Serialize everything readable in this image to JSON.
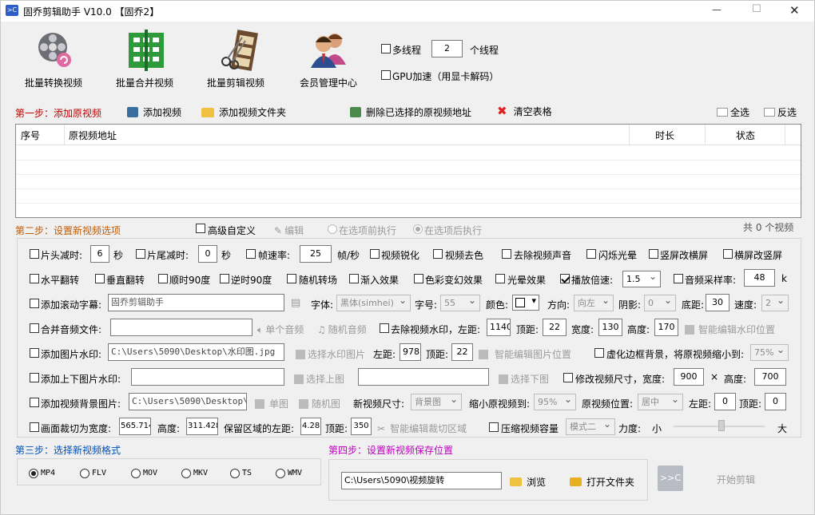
{
  "window": {
    "title": "固乔剪辑助手 V10.0  【固乔2】",
    "buttons": {
      "minimize": "—",
      "maximize": "☐",
      "close": "✕"
    }
  },
  "toolbar": {
    "batch_convert": "批量转换视频",
    "batch_merge": "批量合并视频",
    "batch_edit": "批量剪辑视频",
    "member_center": "会员管理中心",
    "multithread_label": "多线程",
    "thread_count": "2",
    "thread_unit": "个线程",
    "gpu_label": "GPU加速（用显卡解码）"
  },
  "step1": {
    "title": "第一步：添加原视频",
    "add_video": "添加视频",
    "add_folder": "添加视频文件夹",
    "delete_selected": "删除已选择的原视频地址",
    "clear_table": "清空表格",
    "select_all": "全选",
    "invert": "反选",
    "columns": [
      "序号",
      "原视频地址",
      "时长",
      "状态"
    ],
    "count": "共 0 个视频"
  },
  "step2": {
    "title": "第二步：设置新视频选项",
    "advanced_custom": "高级自定义",
    "edit": "编辑",
    "before_option": "在选项前执行",
    "after_option": "在选项后执行",
    "row1": {
      "head_trim": "片头减时:",
      "head_val": "6",
      "sec1": "秒",
      "tail_trim": "片尾减时:",
      "tail_val": "0",
      "sec2": "秒",
      "framerate": "帧速率:",
      "framerate_val": "25",
      "fps_unit": "帧/秒",
      "sharpen": "视频锐化",
      "decolor": "视频去色",
      "mute": "去除视频声音",
      "flash": "闪烁光晕",
      "v2h": "竖屏改横屏",
      "h2v": "横屏改竖屏"
    },
    "row2": {
      "hflip": "水平翻转",
      "vflip": "垂直翻转",
      "rot90cw": "顺时90度",
      "rot90ccw": "逆时90度",
      "random_trans": "随机转场",
      "fade_in": "渐入效果",
      "color_effect": "色彩变幻效果",
      "halo": "光晕效果",
      "speed": "播放倍速:",
      "speed_val": "1.5",
      "audio_rate": "音频采样率:",
      "audio_rate_val": "48",
      "audio_unit": "k"
    },
    "row3": {
      "scroll_sub": "添加滚动字幕:",
      "sub_text": "固乔剪辑助手",
      "font_label": "字体:",
      "font_val": "黑体(simhei)",
      "size_label": "字号:",
      "size_val": "55",
      "color_label": "颜色:",
      "dir_label": "方向:",
      "dir_val": "向左",
      "shadow_label": "阴影:",
      "shadow_val": "0",
      "bottom_label": "底距:",
      "bottom_val": "30",
      "speed_label": "速度:",
      "speed_val": "2"
    },
    "row4": {
      "merge_audio": "合并音频文件:",
      "single_audio": "单个音频",
      "random_audio": "随机音频",
      "remove_wm": "去除视频水印，左距:",
      "wm_left": "1140",
      "top_label": "顶距:",
      "wm_top": "22",
      "width_label": "宽度:",
      "wm_width": "130",
      "height_label": "高度:",
      "wm_height": "170",
      "smart_wm": "智能编辑水印位置"
    },
    "row5": {
      "img_wm": "添加图片水印:",
      "img_path": "C:\\Users\\5090\\Desktop\\水印图.jpg",
      "choose_wm": "选择水印图片",
      "left_label": "左距:",
      "left_val": "978",
      "top_label": "顶距:",
      "top_val": "22",
      "smart_img": "智能编辑图片位置",
      "blur_bg": "虚化边框背景，将原视频缩小到:",
      "blur_val": "75%"
    },
    "row6": {
      "topbottom_img": "添加上下图片水印:",
      "choose_top": "选择上图",
      "choose_bottom": "选择下图",
      "resize": "修改视频尺寸，宽度:",
      "resize_w": "900",
      "times": "×",
      "height_label": "高度:",
      "resize_h": "700"
    },
    "row7": {
      "bg_img": "添加视频背景图片:",
      "bg_path": "C:\\Users\\5090\\Desktop\\背",
      "single_img": "单图",
      "random_img": "随机图",
      "new_size": "新视频尺寸:",
      "new_size_val": "背景图",
      "shrink": "缩小原视频到:",
      "shrink_val": "95%",
      "pos": "原视频位置:",
      "pos_val": "居中",
      "left_label": "左距:",
      "left_val": "0",
      "top_label": "顶距:",
      "top_val": "0"
    },
    "row8": {
      "crop": "画面裁切为宽度:",
      "crop_w": "565.714",
      "height_label": "高度:",
      "crop_h": "311.428",
      "keep_left": "保留区域的左距:",
      "keep_left_val": "4.28",
      "top_label": "顶距:",
      "keep_top": "350",
      "smart_crop": "智能编辑裁切区域",
      "compress": "压缩视频容量",
      "mode_val": "模式二",
      "force": "力度:",
      "small": "小",
      "large": "大"
    }
  },
  "step3": {
    "title": "第三步：选择新视频格式",
    "formats": [
      "MP4",
      "FLV",
      "MOV",
      "MKV",
      "TS",
      "WMV"
    ],
    "selected": "MP4"
  },
  "step4": {
    "title": "第四步：设置新视频保存位置",
    "path": "C:\\Users\\5090\\视频旋转",
    "browse": "浏览",
    "open_folder": "打开文件夹",
    "start": "开始剪辑",
    "start_logo": ">>C"
  },
  "colors": {
    "step_orange": "#c05a00",
    "step_blue": "#0050b4",
    "step_magenta": "#c000c0",
    "disabled": "#9a9a9a"
  }
}
